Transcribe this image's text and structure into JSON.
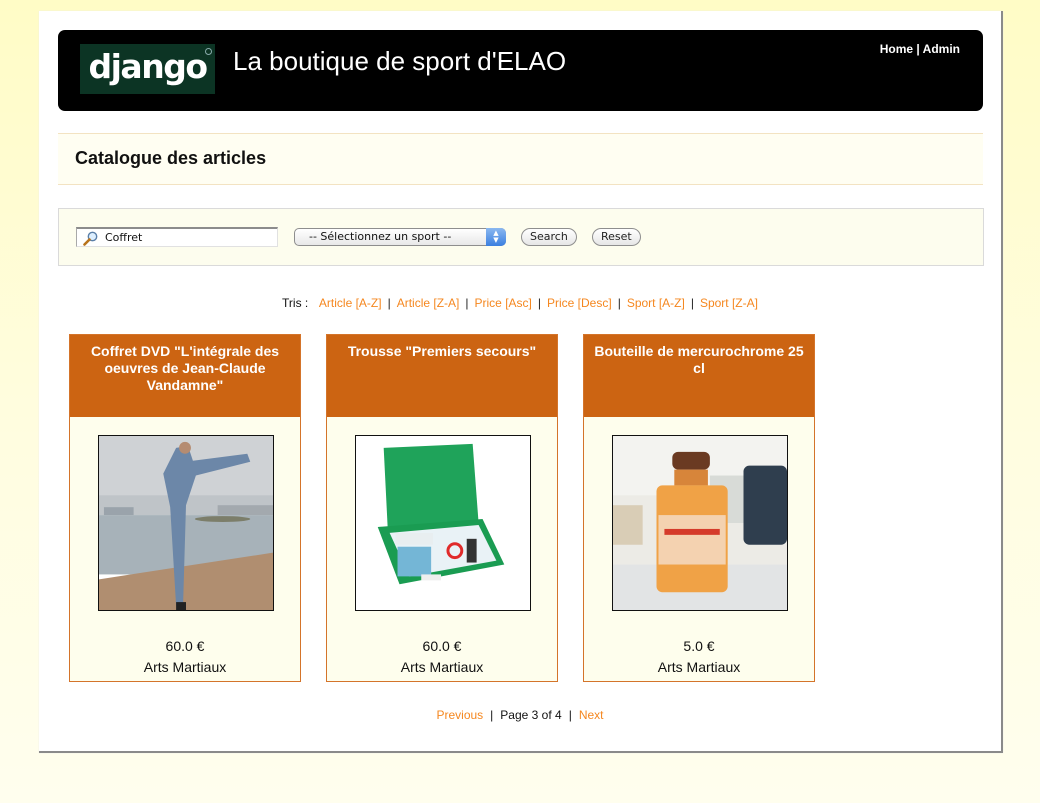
{
  "header": {
    "logo_text": "django",
    "site_title": "La boutique de sport d'ELAO",
    "nav": [
      {
        "label": "Home"
      },
      {
        "label": "Admin"
      }
    ],
    "nav_separator": "|"
  },
  "page": {
    "title": "Catalogue des articles"
  },
  "search": {
    "icon": "magnifier-icon",
    "query_value": "Coffret",
    "sport_select_value": "-- Sélectionnez un sport --",
    "search_label": "Search",
    "reset_label": "Reset"
  },
  "sort": {
    "label": "Tris :",
    "separator": "|",
    "options": [
      {
        "label": "Article [A-Z]"
      },
      {
        "label": "Article [Z-A]"
      },
      {
        "label": "Price [Asc]"
      },
      {
        "label": "Price [Desc]"
      },
      {
        "label": "Sport [A-Z]"
      },
      {
        "label": "Sport [Z-A]"
      }
    ]
  },
  "products": [
    {
      "name": "Coffret DVD \"L'intégrale des oeuvres de Jean-Claude Vandamne\"",
      "price": "60.0 €",
      "sport": "Arts Martiaux",
      "image": "martial-arts-kick-photo"
    },
    {
      "name": "Trousse \"Premiers secours\"",
      "price": "60.0 €",
      "sport": "Arts Martiaux",
      "image": "first-aid-kit-photo"
    },
    {
      "name": "Bouteille de mercurochrome 25 cl",
      "price": "5.0 €",
      "sport": "Arts Martiaux",
      "image": "mercurochrome-bottle-photo"
    }
  ],
  "pagination": {
    "previous_label": "Previous",
    "status": "Page 3 of 4",
    "next_label": "Next",
    "separator": "|",
    "current_page": 3,
    "total_pages": 4
  },
  "colors": {
    "accent": "#cc6412",
    "link": "#f5871f",
    "header_bg": "#000000",
    "logo_bg": "#0c3424",
    "page_bg": "#fffcc6"
  }
}
